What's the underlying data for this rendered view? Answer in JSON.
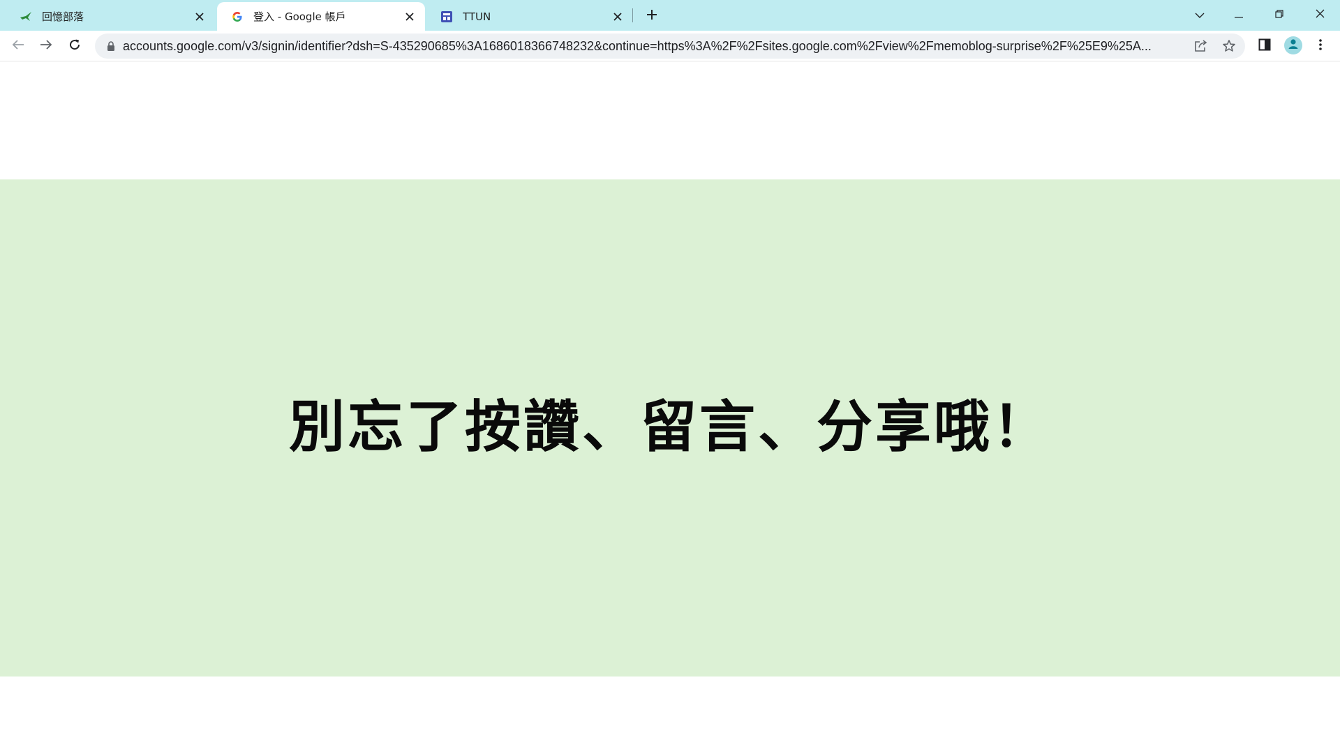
{
  "tabs": [
    {
      "title": "回憶部落",
      "favicon": "bird-icon",
      "active": false
    },
    {
      "title": "登入 - Google 帳戶",
      "favicon": "google-g-icon",
      "active": true
    },
    {
      "title": "TTUN",
      "favicon": "sites-icon",
      "active": false
    }
  ],
  "address_bar": {
    "url": "accounts.google.com/v3/signin/identifier?dsh=S-435290685%3A1686018366748232&continue=https%3A%2F%2Fsites.google.com%2Fview%2Fmemoblog-surprise%2F%25E9%25A..."
  },
  "page": {
    "banner_text": "別忘了按讚、留言、分享哦！",
    "banner_color": "#dcf1d5"
  },
  "colors": {
    "tabstrip": "#bfecf1",
    "omnibox": "#eef1f4"
  }
}
